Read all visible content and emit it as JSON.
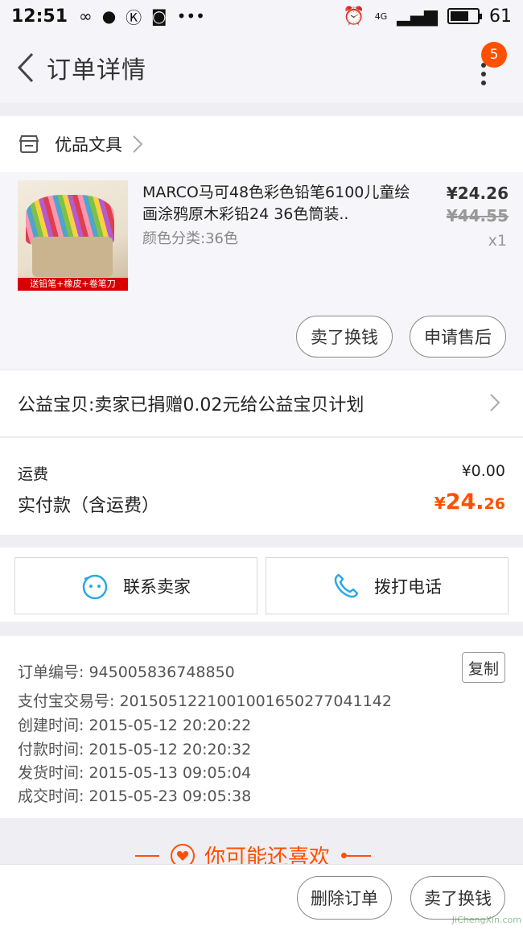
{
  "status_bar": {
    "time": "12:51",
    "battery": "61",
    "network": "4G",
    "dots": "•••"
  },
  "header": {
    "title": "订单详情",
    "badge_count": "5"
  },
  "shop": {
    "name": "优品文具"
  },
  "item": {
    "title": "MARCO马可48色彩色铅笔6100儿童绘画涂鸦原木彩铅24 36色筒装..",
    "sku": "颜色分类:36色",
    "price": "¥24.26",
    "original_price": "¥44.55",
    "quantity": "x1",
    "thumb_banner": "送铅笔+橡皮+卷笔刀"
  },
  "item_actions": {
    "sell_label": "卖了换钱",
    "after_sale_label": "申请售后"
  },
  "charity": {
    "text": "公益宝贝:卖家已捐赠0.02元给公益宝贝计划"
  },
  "cost": {
    "shipping_label": "运费",
    "shipping_value": "¥0.00",
    "paid_label": "实付款（含运费）",
    "paid_currency": "¥",
    "paid_int": "24.",
    "paid_dec": "26"
  },
  "contact": {
    "seller_label": "联系卖家",
    "phone_label": "拨打电话"
  },
  "order_info": {
    "copy_label": "复制",
    "lines": [
      "订单编号: 945005836748850",
      "支付宝交易号: 2015051221001001650277041142",
      "创建时间: 2015-05-12 20:20:22",
      "付款时间: 2015-05-12 20:20:32",
      "发货时间: 2015-05-13 09:05:04",
      "成交时间: 2015-05-23 09:05:38"
    ]
  },
  "recommend": {
    "title": "你可能还喜欢"
  },
  "bottom_bar": {
    "delete_label": "删除订单",
    "sell_label": "卖了换钱"
  },
  "watermark": "JiChengXin.com",
  "colors": {
    "accent": "#ff5000",
    "text": "#222222",
    "muted": "#888888"
  }
}
